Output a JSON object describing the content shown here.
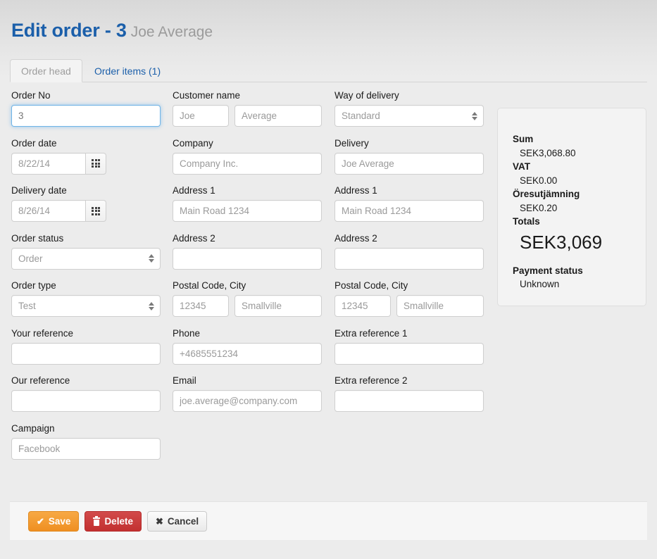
{
  "header": {
    "title": "Edit order - 3",
    "customer": "Joe Average"
  },
  "tabs": [
    {
      "label": "Order head",
      "active": true
    },
    {
      "label": "Order items (1)",
      "active": false
    }
  ],
  "form": {
    "column_1": {
      "order_no": {
        "label": "Order No",
        "value": "3",
        "focused": true
      },
      "order_date": {
        "label": "Order date",
        "value": "8/22/14",
        "button_icon": "calendar-grid-icon"
      },
      "delivery_date": {
        "label": "Delivery date",
        "value": "8/26/14",
        "button_icon": "calendar-grid-icon"
      },
      "order_status": {
        "label": "Order status",
        "value": "Order",
        "options": [
          "Order"
        ]
      },
      "order_type": {
        "label": "Order type",
        "value": "Test",
        "options": [
          "Test"
        ]
      },
      "your_reference": {
        "label": "Your reference",
        "value": ""
      },
      "our_reference": {
        "label": "Our reference",
        "value": ""
      },
      "campaign": {
        "label": "Campaign",
        "value": "Facebook"
      }
    },
    "column_2": {
      "customer_name": {
        "label": "Customer name",
        "first": "Joe",
        "last": "Average"
      },
      "company": {
        "label": "Company",
        "value": "Company Inc."
      },
      "address_1": {
        "label": "Address 1",
        "value": "Main Road 1234"
      },
      "address_2": {
        "label": "Address 2",
        "value": ""
      },
      "postal_city": {
        "label": "Postal Code, City",
        "postal": "12345",
        "city": "Smallville"
      },
      "phone": {
        "label": "Phone",
        "value": "+4685551234"
      },
      "email": {
        "label": "Email",
        "value": "joe.average@company.com"
      }
    },
    "column_3": {
      "way_of_delivery": {
        "label": "Way of delivery",
        "value": "Standard",
        "options": [
          "Standard"
        ]
      },
      "delivery": {
        "label": "Delivery",
        "value": "Joe Average"
      },
      "address_1": {
        "label": "Address 1",
        "value": "Main Road 1234"
      },
      "address_2": {
        "label": "Address 2",
        "value": ""
      },
      "postal_city": {
        "label": "Postal Code, City",
        "postal": "12345",
        "city": "Smallville"
      },
      "extra_reference_1": {
        "label": "Extra reference 1",
        "value": ""
      },
      "extra_reference_2": {
        "label": "Extra reference 2",
        "value": ""
      }
    }
  },
  "summary": {
    "sum_label": "Sum",
    "sum_value": "SEK3,068.80",
    "vat_label": "VAT",
    "vat_value": "SEK0.00",
    "rounding_label": "Öresutjämning",
    "rounding_value": "SEK0.20",
    "totals_label": "Totals",
    "totals_value": "SEK3,069",
    "payment_status_label": "Payment status",
    "payment_status_value": "Unknown"
  },
  "footer": {
    "save": "Save",
    "delete": "Delete",
    "cancel": "Cancel"
  },
  "colors": {
    "title_blue": "#1b5faa",
    "save_orange": "#ef8f21",
    "delete_red": "#c23030",
    "focus_blue": "#70b5e8"
  }
}
